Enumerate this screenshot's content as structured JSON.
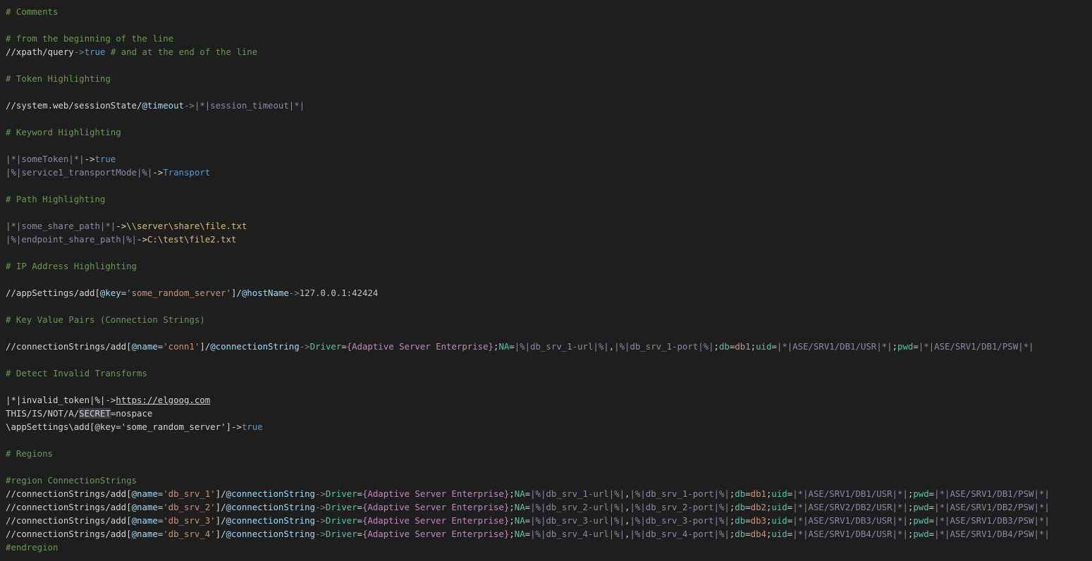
{
  "editor": {
    "colors": {
      "background": "#1e1e1e",
      "comment": "#6a9955",
      "plain": "#d4d4d4",
      "boolean": "#569cd6",
      "token": "#8a8aa8",
      "attribute": "#9cdcfe",
      "string": "#ce9178",
      "number": "#b5cea8",
      "key": "#4ec9b0",
      "brace": "#c586c0",
      "path": "#d7ba7d",
      "identifier": "#4fc1ff"
    },
    "lines": [
      {
        "tokens": [
          {
            "t": "# Comments",
            "c": "comment"
          }
        ]
      },
      {
        "tokens": []
      },
      {
        "tokens": [
          {
            "t": "# from the beginning of the line",
            "c": "comment"
          }
        ]
      },
      {
        "tokens": [
          {
            "t": "//xpath/query",
            "c": "plain"
          },
          {
            "t": "->",
            "c": "arrow"
          },
          {
            "t": "true",
            "c": "bool"
          },
          {
            "t": " # and at the end of the line",
            "c": "comment"
          }
        ]
      },
      {
        "tokens": []
      },
      {
        "tokens": [
          {
            "t": "# Token Highlighting",
            "c": "comment"
          }
        ]
      },
      {
        "tokens": []
      },
      {
        "tokens": [
          {
            "t": "//system.web/sessionState/",
            "c": "plain"
          },
          {
            "t": "@timeout",
            "c": "attr"
          },
          {
            "t": "->",
            "c": "arrow"
          },
          {
            "t": "|*|session_timeout|*|",
            "c": "token"
          }
        ]
      },
      {
        "tokens": []
      },
      {
        "tokens": [
          {
            "t": "# Keyword Highlighting",
            "c": "comment"
          }
        ]
      },
      {
        "tokens": []
      },
      {
        "tokens": [
          {
            "t": "|*|someToken|*|",
            "c": "token"
          },
          {
            "t": "->",
            "c": "plain"
          },
          {
            "t": "true",
            "c": "bool"
          }
        ]
      },
      {
        "tokens": [
          {
            "t": "|%|service1_transportMode|%|",
            "c": "token"
          },
          {
            "t": "->",
            "c": "plain"
          },
          {
            "t": "Transport",
            "c": "bool"
          }
        ]
      },
      {
        "tokens": []
      },
      {
        "tokens": [
          {
            "t": "# Path Highlighting",
            "c": "comment"
          }
        ]
      },
      {
        "tokens": []
      },
      {
        "tokens": [
          {
            "t": "|*|some_share_path|*|",
            "c": "token"
          },
          {
            "t": "->",
            "c": "plain"
          },
          {
            "t": "\\\\server\\share\\file.txt",
            "c": "path"
          }
        ]
      },
      {
        "tokens": [
          {
            "t": "|%|endpoint_share_path|%|",
            "c": "token"
          },
          {
            "t": "->",
            "c": "plain"
          },
          {
            "t": "C:\\test\\file2.txt",
            "c": "path"
          }
        ]
      },
      {
        "tokens": []
      },
      {
        "tokens": [
          {
            "t": "# IP Address Highlighting",
            "c": "comment"
          }
        ]
      },
      {
        "tokens": []
      },
      {
        "tokens": [
          {
            "t": "//appSettings/add[",
            "c": "plain"
          },
          {
            "t": "@key",
            "c": "attr"
          },
          {
            "t": "=",
            "c": "plain"
          },
          {
            "t": "'some_random_server'",
            "c": "str"
          },
          {
            "t": "]/",
            "c": "plain"
          },
          {
            "t": "@hostName",
            "c": "attr"
          },
          {
            "t": "->",
            "c": "arrow"
          },
          {
            "t": "127.0.0.1:42424",
            "c": "num"
          }
        ]
      },
      {
        "tokens": []
      },
      {
        "tokens": [
          {
            "t": "# Key Value Pairs (Connection Strings)",
            "c": "comment"
          }
        ]
      },
      {
        "tokens": []
      },
      {
        "tokens": [
          {
            "t": "//connectionStrings/add[",
            "c": "plain"
          },
          {
            "t": "@name",
            "c": "attr"
          },
          {
            "t": "=",
            "c": "plain"
          },
          {
            "t": "'conn1'",
            "c": "str"
          },
          {
            "t": "]/",
            "c": "plain"
          },
          {
            "t": "@connectionString",
            "c": "attr"
          },
          {
            "t": "->",
            "c": "arrow"
          },
          {
            "t": "Driver",
            "c": "keyname"
          },
          {
            "t": "=",
            "c": "delim"
          },
          {
            "t": "{Adaptive Server Enterprise}",
            "c": "brace"
          },
          {
            "t": ";",
            "c": "delim"
          },
          {
            "t": "NA",
            "c": "keyname"
          },
          {
            "t": "=",
            "c": "delim"
          },
          {
            "t": "|%|db_srv_1-url|%|",
            "c": "token"
          },
          {
            "t": ",",
            "c": "delim"
          },
          {
            "t": "|%|db_srv_1-port|%|",
            "c": "token"
          },
          {
            "t": ";",
            "c": "delim"
          },
          {
            "t": "db",
            "c": "keyname"
          },
          {
            "t": "=",
            "c": "delim"
          },
          {
            "t": "db1",
            "c": "keyval"
          },
          {
            "t": ";",
            "c": "delim"
          },
          {
            "t": "uid",
            "c": "keyname"
          },
          {
            "t": "=",
            "c": "delim"
          },
          {
            "t": "|*|ASE/SRV1/DB1/USR|*|",
            "c": "token"
          },
          {
            "t": ";",
            "c": "delim"
          },
          {
            "t": "pwd",
            "c": "keyname"
          },
          {
            "t": "=",
            "c": "delim"
          },
          {
            "t": "|*|ASE/SRV1/DB1/PSW|*|",
            "c": "token"
          }
        ]
      },
      {
        "tokens": []
      },
      {
        "tokens": [
          {
            "t": "# Detect Invalid Transforms",
            "c": "comment"
          }
        ]
      },
      {
        "tokens": []
      },
      {
        "tokens": [
          {
            "t": "|*|invalid_token|%|",
            "c": "plain"
          },
          {
            "t": "->",
            "c": "plain"
          },
          {
            "t": "https://elgoog.com",
            "c": "link"
          }
        ]
      },
      {
        "tokens": [
          {
            "t": "THIS/IS/NOT/A/",
            "c": "plain"
          },
          {
            "t": "SECRET",
            "c": "highlight"
          },
          {
            "t": "=nospace",
            "c": "plain"
          }
        ]
      },
      {
        "tokens": [
          {
            "t": "\\appSettings\\add[@key='some_random_server']",
            "c": "plain"
          },
          {
            "t": "->",
            "c": "plain"
          },
          {
            "t": "true",
            "c": "bool"
          }
        ]
      },
      {
        "tokens": []
      },
      {
        "tokens": [
          {
            "t": "# Regions",
            "c": "comment"
          }
        ]
      },
      {
        "tokens": []
      },
      {
        "tokens": [
          {
            "t": "#region ConnectionStrings",
            "c": "region"
          }
        ]
      },
      {
        "tokens": [
          {
            "t": "//connectionStrings/add[",
            "c": "plain"
          },
          {
            "t": "@name",
            "c": "attr"
          },
          {
            "t": "=",
            "c": "plain"
          },
          {
            "t": "'db_srv_1'",
            "c": "str"
          },
          {
            "t": "]/",
            "c": "plain"
          },
          {
            "t": "@connectionString",
            "c": "attr"
          },
          {
            "t": "->",
            "c": "arrow"
          },
          {
            "t": "Driver",
            "c": "keyname"
          },
          {
            "t": "=",
            "c": "delim"
          },
          {
            "t": "{Adaptive Server Enterprise}",
            "c": "brace"
          },
          {
            "t": ";",
            "c": "delim"
          },
          {
            "t": "NA",
            "c": "keyname"
          },
          {
            "t": "=",
            "c": "delim"
          },
          {
            "t": "|%|db_srv_1-url|%|",
            "c": "token"
          },
          {
            "t": ",",
            "c": "delim"
          },
          {
            "t": "|%|db_srv_1-port|%|",
            "c": "token"
          },
          {
            "t": ";",
            "c": "delim"
          },
          {
            "t": "db",
            "c": "keyname"
          },
          {
            "t": "=",
            "c": "delim"
          },
          {
            "t": "db1",
            "c": "keyval"
          },
          {
            "t": ";",
            "c": "delim"
          },
          {
            "t": "uid",
            "c": "keyname"
          },
          {
            "t": "=",
            "c": "delim"
          },
          {
            "t": "|*|ASE/SRV1/DB1/USR|*|",
            "c": "token"
          },
          {
            "t": ";",
            "c": "delim"
          },
          {
            "t": "pwd",
            "c": "keyname"
          },
          {
            "t": "=",
            "c": "delim"
          },
          {
            "t": "|*|ASE/SRV1/DB1/PSW|*|",
            "c": "token"
          }
        ]
      },
      {
        "tokens": [
          {
            "t": "//connectionStrings/add[",
            "c": "plain"
          },
          {
            "t": "@name",
            "c": "attr"
          },
          {
            "t": "=",
            "c": "plain"
          },
          {
            "t": "'db_srv_2'",
            "c": "str"
          },
          {
            "t": "]/",
            "c": "plain"
          },
          {
            "t": "@connectionString",
            "c": "attr"
          },
          {
            "t": "->",
            "c": "arrow"
          },
          {
            "t": "Driver",
            "c": "keyname"
          },
          {
            "t": "=",
            "c": "delim"
          },
          {
            "t": "{Adaptive Server Enterprise}",
            "c": "brace"
          },
          {
            "t": ";",
            "c": "delim"
          },
          {
            "t": "NA",
            "c": "keyname"
          },
          {
            "t": "=",
            "c": "delim"
          },
          {
            "t": "|%|db_srv_2-url|%|",
            "c": "token"
          },
          {
            "t": ",",
            "c": "delim"
          },
          {
            "t": "|%|db_srv_2-port|%|",
            "c": "token"
          },
          {
            "t": ";",
            "c": "delim"
          },
          {
            "t": "db",
            "c": "keyname"
          },
          {
            "t": "=",
            "c": "delim"
          },
          {
            "t": "db2",
            "c": "keyval"
          },
          {
            "t": ";",
            "c": "delim"
          },
          {
            "t": "uid",
            "c": "keyname"
          },
          {
            "t": "=",
            "c": "delim"
          },
          {
            "t": "|*|ASE/SRV2/DB2/USR|*|",
            "c": "token"
          },
          {
            "t": ";",
            "c": "delim"
          },
          {
            "t": "pwd",
            "c": "keyname"
          },
          {
            "t": "=",
            "c": "delim"
          },
          {
            "t": "|*|ASE/SRV1/DB2/PSW|*|",
            "c": "token"
          }
        ]
      },
      {
        "tokens": [
          {
            "t": "//connectionStrings/add[",
            "c": "plain"
          },
          {
            "t": "@name",
            "c": "attr"
          },
          {
            "t": "=",
            "c": "plain"
          },
          {
            "t": "'db_srv_3'",
            "c": "str"
          },
          {
            "t": "]/",
            "c": "plain"
          },
          {
            "t": "@connectionString",
            "c": "attr"
          },
          {
            "t": "->",
            "c": "arrow"
          },
          {
            "t": "Driver",
            "c": "keyname"
          },
          {
            "t": "=",
            "c": "delim"
          },
          {
            "t": "{Adaptive Server Enterprise}",
            "c": "brace"
          },
          {
            "t": ";",
            "c": "delim"
          },
          {
            "t": "NA",
            "c": "keyname"
          },
          {
            "t": "=",
            "c": "delim"
          },
          {
            "t": "|%|db_srv_3-url|%|",
            "c": "token"
          },
          {
            "t": ",",
            "c": "delim"
          },
          {
            "t": "|%|db_srv_3-port|%|",
            "c": "token"
          },
          {
            "t": ";",
            "c": "delim"
          },
          {
            "t": "db",
            "c": "keyname"
          },
          {
            "t": "=",
            "c": "delim"
          },
          {
            "t": "db3",
            "c": "keyval"
          },
          {
            "t": ";",
            "c": "delim"
          },
          {
            "t": "uid",
            "c": "keyname"
          },
          {
            "t": "=",
            "c": "delim"
          },
          {
            "t": "|*|ASE/SRV1/DB3/USR|*|",
            "c": "token"
          },
          {
            "t": ";",
            "c": "delim"
          },
          {
            "t": "pwd",
            "c": "keyname"
          },
          {
            "t": "=",
            "c": "delim"
          },
          {
            "t": "|*|ASE/SRV1/DB3/PSW|*|",
            "c": "token"
          }
        ]
      },
      {
        "tokens": [
          {
            "t": "//connectionStrings/add[",
            "c": "plain"
          },
          {
            "t": "@name",
            "c": "attr"
          },
          {
            "t": "=",
            "c": "plain"
          },
          {
            "t": "'db_srv_4'",
            "c": "str"
          },
          {
            "t": "]/",
            "c": "plain"
          },
          {
            "t": "@connectionString",
            "c": "attr"
          },
          {
            "t": "->",
            "c": "arrow"
          },
          {
            "t": "Driver",
            "c": "keyname"
          },
          {
            "t": "=",
            "c": "delim"
          },
          {
            "t": "{Adaptive Server Enterprise}",
            "c": "brace"
          },
          {
            "t": ";",
            "c": "delim"
          },
          {
            "t": "NA",
            "c": "keyname"
          },
          {
            "t": "=",
            "c": "delim"
          },
          {
            "t": "|%|db_srv_4-url|%|",
            "c": "token"
          },
          {
            "t": ",",
            "c": "delim"
          },
          {
            "t": "|%|db_srv_4-port|%|",
            "c": "token"
          },
          {
            "t": ";",
            "c": "delim"
          },
          {
            "t": "db",
            "c": "keyname"
          },
          {
            "t": "=",
            "c": "delim"
          },
          {
            "t": "db4",
            "c": "keyval"
          },
          {
            "t": ";",
            "c": "delim"
          },
          {
            "t": "uid",
            "c": "keyname"
          },
          {
            "t": "=",
            "c": "delim"
          },
          {
            "t": "|*|ASE/SRV1/DB4/USR|*|",
            "c": "token"
          },
          {
            "t": ";",
            "c": "delim"
          },
          {
            "t": "pwd",
            "c": "keyname"
          },
          {
            "t": "=",
            "c": "delim"
          },
          {
            "t": "|*|ASE/SRV1/DB4/PSW|*|",
            "c": "token"
          }
        ]
      },
      {
        "tokens": [
          {
            "t": "#endregion",
            "c": "region"
          }
        ]
      }
    ]
  }
}
